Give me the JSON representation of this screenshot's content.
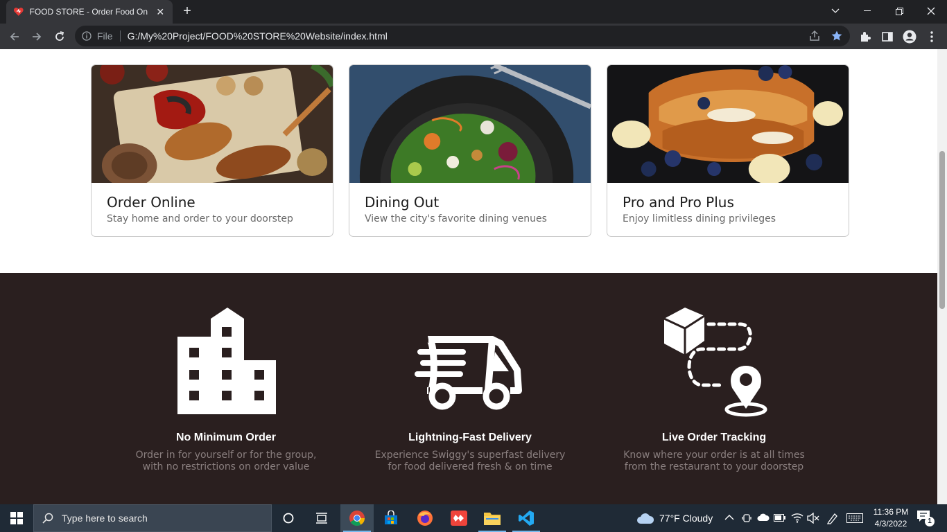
{
  "browser": {
    "tab_title": "FOOD STORE - Order Food Online",
    "omnibox_scheme": "File",
    "url": "G:/My%20Project/FOOD%20STORE%20Website/index.html"
  },
  "cards": [
    {
      "title": "Order Online",
      "subtitle": "Stay home and order to your doorstep"
    },
    {
      "title": "Dining Out",
      "subtitle": "View the city's favorite dining venues"
    },
    {
      "title": "Pro and Pro Plus",
      "subtitle": "Enjoy limitless dining privileges"
    }
  ],
  "features": [
    {
      "title": "No Minimum Order",
      "desc_line1": "Order in for yourself or for the group,",
      "desc_line2": "with no restrictions on order value"
    },
    {
      "title": "Lightning-Fast Delivery",
      "desc_line1": "Experience Swiggy's superfast delivery",
      "desc_line2": "for food delivered fresh & on time"
    },
    {
      "title": "Live Order Tracking",
      "desc_line1": "Know where your order is at all times",
      "desc_line2": "from the restaurant to your doorstep"
    }
  ],
  "taskbar": {
    "search_placeholder": "Type here to search",
    "weather": "77°F  Cloudy",
    "time": "11:36 PM",
    "date": "4/3/2022",
    "notification_count": "1"
  },
  "colors": {
    "feature_bg": "#2a1f1f",
    "browser_dark": "#202124",
    "accent_blue": "#8ab4f8"
  }
}
